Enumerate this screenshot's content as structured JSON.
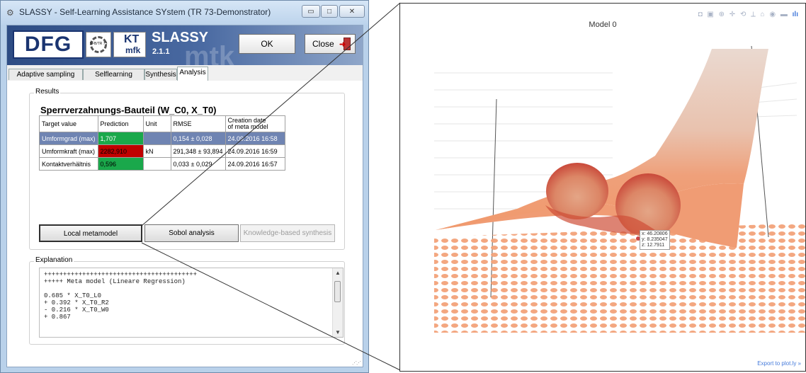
{
  "window": {
    "title": "SLASSY - Self-Learning Assistance SYstem (TR 73-Demonstrator)",
    "minimize": "▭",
    "maximize": "□",
    "close": "✕"
  },
  "banner": {
    "dfg": "DFG",
    "sfb": "SFB/TR 73",
    "kt_top": "KT",
    "kt_bottom": "mfk",
    "watermark": "mtk",
    "app_name": "SLASSY",
    "version": "2.1.1",
    "ok_label": "OK",
    "close_label": "Close"
  },
  "tabs": [
    {
      "label": "Adaptive sampling"
    },
    {
      "label": "Selflearning process"
    },
    {
      "label": "Synthesis"
    },
    {
      "label": "Analysis"
    }
  ],
  "results": {
    "group_label": "Results",
    "table_title": "Sperrverzahnungs-Bauteil (W_C0, X_T0)",
    "headers": [
      "Target value",
      "Prediction",
      "Unit",
      "RMSE",
      "Creation date",
      "of meta model"
    ],
    "rows": [
      {
        "target": "Umformgrad (max)",
        "prediction": "1,707",
        "unit": "",
        "rmse": "0,154 ± 0,028",
        "date": "24.09.2016 16:58"
      },
      {
        "target": "Umformkraft (max)",
        "prediction": "2282,910",
        "unit": "kN",
        "rmse": "291,348 ± 93,894",
        "date": "24.09.2016 16:59"
      },
      {
        "target": "Kontaktverhältnis",
        "prediction": "0,596",
        "unit": "",
        "rmse": "0,033 ± 0,029",
        "date": "24.09.2016 16:57"
      }
    ],
    "buttons": {
      "local": "Local metamodel",
      "sobol": "Sobol analysis",
      "knowledge": "Knowledge-based synthesis"
    }
  },
  "explanation": {
    "label": "Explanation",
    "text": "++++++++++++++++++++++++++++++++++++++++\n+++++ Meta model (Lineare Regression)\n\n0.685 * X_T0_L0\n+ 0.392 * X_T0_R2\n- 0.216 * X_T0_W0\n+ 0.867"
  },
  "plot": {
    "title": "Model 0",
    "modebar_icons": "◘ ▣ ⊕ ✛ ⟲ ⟂ ⌂ ◉ ▬",
    "plotly_logo": "ılı",
    "hover_x": "x: 46.20806",
    "hover_y": "y: 8.235047",
    "hover_z": "z: 12.7911",
    "export": "Export to plot.ly »"
  },
  "colors": {
    "surface_light": "#e9d7cd",
    "surface_mid": "#f09a6f",
    "surface_dark": "#d0402a",
    "selected_row": "#6f84b2",
    "pred_green": "#1aa84b",
    "pred_red": "#c00000"
  }
}
